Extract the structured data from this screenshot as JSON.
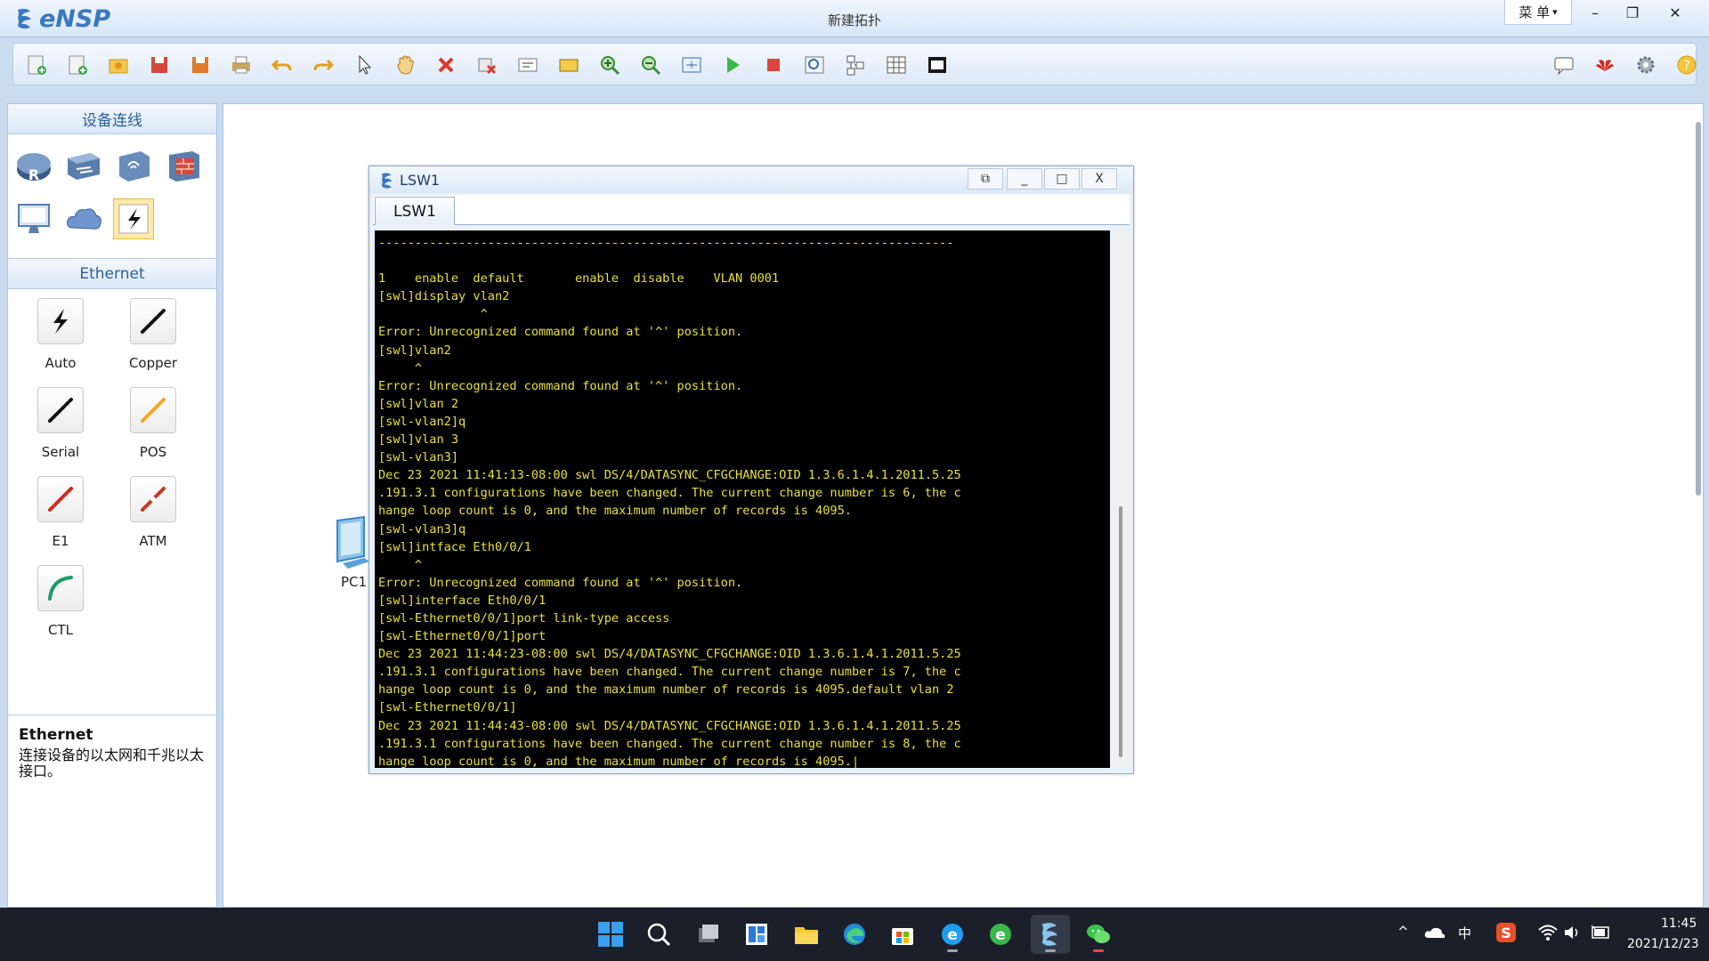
{
  "app": {
    "name": "eNSP",
    "window_title": "新建拓扑",
    "menu_label": "菜 单",
    "menu_arrow": "▾",
    "controls": {
      "minimize": "–",
      "restore": "❐",
      "close": "✕"
    }
  },
  "toolbar": {
    "left_icons": [
      "new-topology-icon",
      "new-example-icon",
      "open-icon",
      "save-icon",
      "save-as-icon",
      "print-icon",
      "undo-icon",
      "redo-icon",
      "select-icon",
      "pan-hand-icon",
      "delete-icon",
      "delete-all-links-icon",
      "text-icon",
      "rectangle-icon",
      "zoom-in-icon",
      "zoom-out-icon",
      "fit-window-icon",
      "start-device-icon",
      "stop-device-icon",
      "capture-icon",
      "topology-icon",
      "grid-icon",
      "screenshot-icon"
    ],
    "right_icons": [
      "chat-icon",
      "huawei-logo-icon",
      "settings-gear-icon",
      "help-icon"
    ]
  },
  "left_panel": {
    "devices_header": "设备连线",
    "device_icons": [
      "router-icon",
      "switch-icon",
      "wireless-icon",
      "firewall-icon",
      "pc-icon",
      "cloud-icon",
      "connection-icon"
    ],
    "ethernet_header": "Ethernet",
    "cables": [
      {
        "label": "Auto",
        "icon": "auto-cable-icon",
        "color": "#111111"
      },
      {
        "label": "Copper",
        "icon": "copper-cable-icon",
        "color": "#111111"
      },
      {
        "label": "Serial",
        "icon": "serial-cable-icon",
        "color": "#111111"
      },
      {
        "label": "POS",
        "icon": "pos-cable-icon",
        "color": "#f5a623"
      },
      {
        "label": "E1",
        "icon": "e1-cable-icon",
        "color": "#d9261c"
      },
      {
        "label": "ATM",
        "icon": "atm-cable-icon",
        "color": "#c8351f"
      },
      {
        "label": "CTL",
        "icon": "ctl-cable-icon",
        "color": "#1e9a6a"
      }
    ],
    "description_title": "Ethernet",
    "description_text": "连接设备的以太网和千兆以太接口。"
  },
  "canvas": {
    "devices": [
      {
        "label": "PC1",
        "icon": "pc-icon"
      }
    ]
  },
  "console": {
    "title": "LSW1",
    "tab_label": "LSW1",
    "buttons": {
      "detach": "⧉",
      "minimize": "_",
      "maximize": "□",
      "close": "X"
    },
    "lines": [
      "-------------------------------------------------------------------------------",
      "",
      "1    enable  default       enable  disable    VLAN 0001",
      "[swl]display vlan2",
      "              ^",
      "Error: Unrecognized command found at '^' position.",
      "[swl]vlan2",
      "     ^",
      "Error: Unrecognized command found at '^' position.",
      "[swl]vlan 2",
      "[swl-vlan2]q",
      "[swl]vlan 3",
      "[swl-vlan3]",
      "Dec 23 2021 11:41:13-08:00 swl DS/4/DATASYNC_CFGCHANGE:OID 1.3.6.1.4.1.2011.5.25",
      ".191.3.1 configurations have been changed. The current change number is 6, the c",
      "hange loop count is 0, and the maximum number of records is 4095.",
      "[swl-vlan3]q",
      "[swl]intface Eth0/0/1",
      "     ^",
      "Error: Unrecognized command found at '^' position.",
      "[swl]interface Eth0/0/1",
      "[swl-Ethernet0/0/1]port link-type access",
      "[swl-Ethernet0/0/1]port",
      "Dec 23 2021 11:44:23-08:00 swl DS/4/DATASYNC_CFGCHANGE:OID 1.3.6.1.4.1.2011.5.25",
      ".191.3.1 configurations have been changed. The current change number is 7, the c",
      "hange loop count is 0, and the maximum number of records is 4095.default vlan 2",
      "[swl-Ethernet0/0/1]",
      "Dec 23 2021 11:44:43-08:00 swl DS/4/DATASYNC_CFGCHANGE:OID 1.3.6.1.4.1.2011.5.25",
      ".191.3.1 configurations have been changed. The current change number is 8, the c",
      "hange loop count is 0, and the maximum number of records is 4095.|"
    ],
    "text_color": "#e6e03c"
  },
  "taskbar": {
    "apps": [
      "windows-start-icon",
      "search-icon",
      "task-view-icon",
      "widgets-icon",
      "file-explorer-icon",
      "edge-icon",
      "store-icon",
      "ie-icon",
      "browser-icon",
      "ensp-app-icon",
      "wechat-icon"
    ],
    "tray": {
      "chevron": "^",
      "ime": "中",
      "time": "11:45",
      "date": "2021/12/23"
    }
  }
}
